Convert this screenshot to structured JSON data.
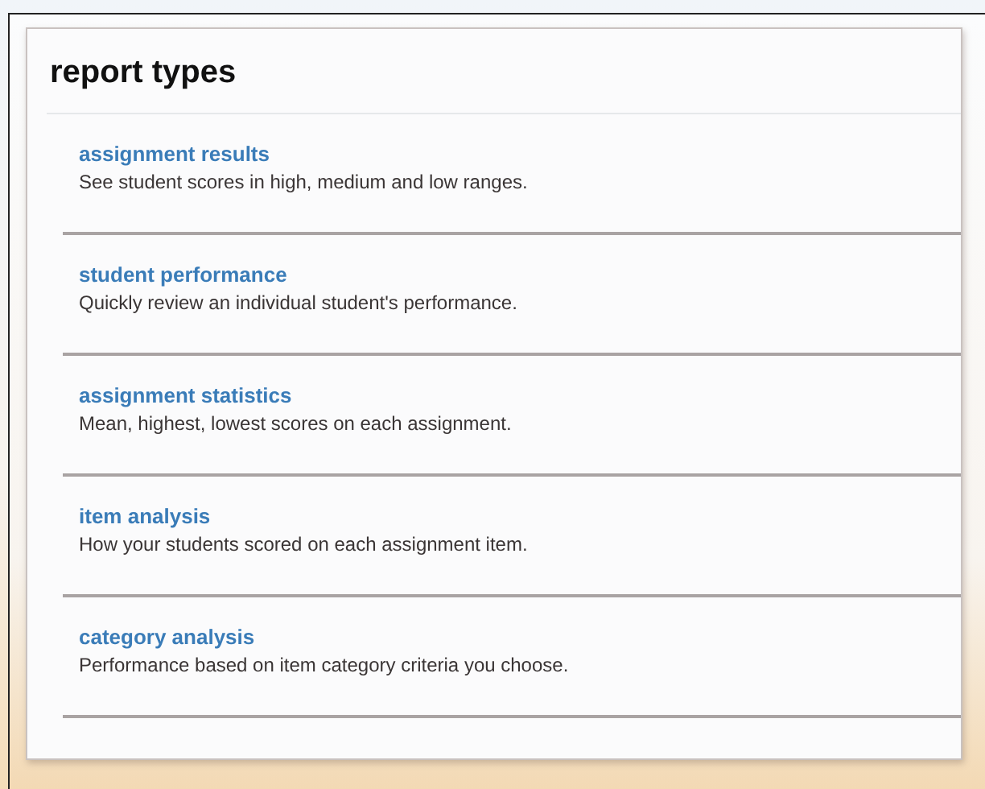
{
  "panel": {
    "title": "report types"
  },
  "report_types": [
    {
      "link": "assignment results",
      "description": "See student scores in high, medium and low ranges."
    },
    {
      "link": "student performance",
      "description": "Quickly review an individual student's performance."
    },
    {
      "link": "assignment statistics",
      "description": "Mean, highest, lowest scores on each assignment."
    },
    {
      "link": "item analysis",
      "description": "How your students scored on each assignment item."
    },
    {
      "link": "category analysis",
      "description": "Performance based on item category criteria you choose."
    }
  ]
}
